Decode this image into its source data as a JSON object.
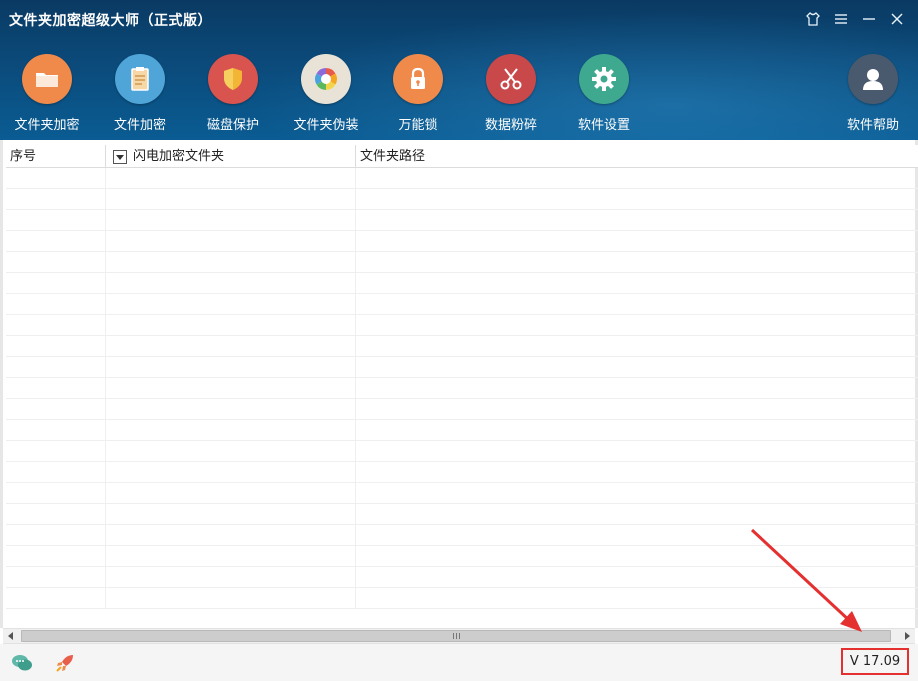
{
  "window": {
    "title": "文件夹加密超级大师（正式版）"
  },
  "toolbar": {
    "items": [
      {
        "label": "文件夹加密",
        "icon": "folder-icon",
        "color": "#f08a4b"
      },
      {
        "label": "文件加密",
        "icon": "clipboard-icon",
        "color": "#4fa5d8"
      },
      {
        "label": "磁盘保护",
        "icon": "shield-icon",
        "color": "#d9534f"
      },
      {
        "label": "文件夹伪装",
        "icon": "color-wheel-icon",
        "color": "#e8e3d6"
      },
      {
        "label": "万能锁",
        "icon": "lock-icon",
        "color": "#f08a4b"
      },
      {
        "label": "数据粉碎",
        "icon": "scissors-icon",
        "color": "#c9494b"
      },
      {
        "label": "软件设置",
        "icon": "gear-icon",
        "color": "#3fa98f"
      }
    ],
    "help": {
      "label": "软件帮助",
      "icon": "user-icon",
      "color": "#4a5a6e"
    }
  },
  "table": {
    "columns": [
      "序号",
      "闪电加密文件夹",
      "文件夹路径"
    ],
    "rows": []
  },
  "status": {
    "version": "V 17.09"
  },
  "colors": {
    "header_bg": "#0b4a7a",
    "highlight": "#e53030"
  }
}
